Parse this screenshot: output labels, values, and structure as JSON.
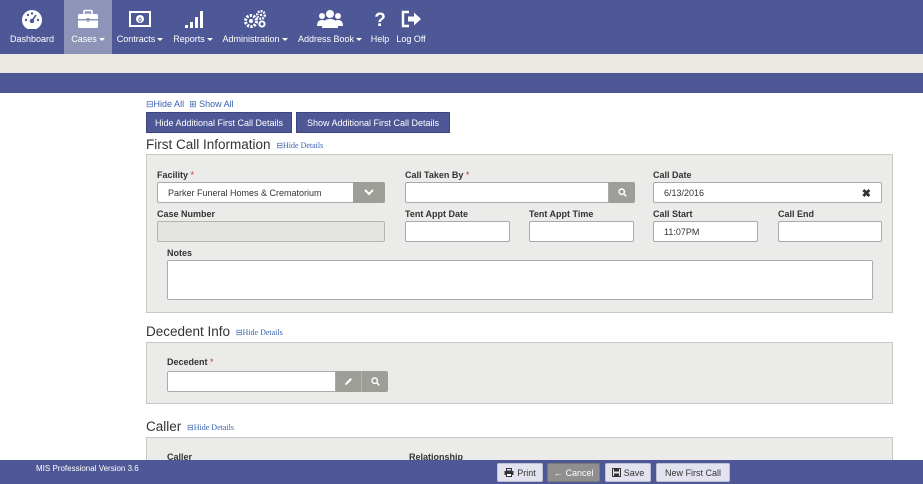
{
  "nav": {
    "items": [
      {
        "label": "Dashboard",
        "icon": "dashboard-icon",
        "has_caret": false
      },
      {
        "label": "Cases",
        "icon": "briefcase-icon",
        "has_caret": true,
        "active": true
      },
      {
        "label": "Contracts",
        "icon": "money-icon",
        "has_caret": true
      },
      {
        "label": "Reports",
        "icon": "bar-chart-icon",
        "has_caret": true
      },
      {
        "label": "Administration",
        "icon": "cogs-icon",
        "has_caret": true
      },
      {
        "label": "Address Book",
        "icon": "users-icon",
        "has_caret": true
      },
      {
        "label": "Help",
        "icon": "question-icon",
        "has_caret": false
      },
      {
        "label": "Log Off",
        "icon": "sign-out-icon",
        "has_caret": false
      }
    ]
  },
  "toggles": {
    "hide_all": "Hide All",
    "show_all": "Show All"
  },
  "buttons": {
    "hide_additional": "Hide Additional First Call Details",
    "show_additional": "Show Additional First Call Details"
  },
  "first_call": {
    "title": "First Call Information",
    "hide_details": "Hide Details",
    "facility_label": "Facility",
    "facility_value": "Parker Funeral Homes & Crematorium",
    "call_taken_by_label": "Call Taken By",
    "call_taken_by_value": "",
    "call_date_label": "Call Date",
    "call_date_value": "6/13/2016",
    "case_number_label": "Case Number",
    "case_number_value": "",
    "tent_appt_date_label": "Tent Appt Date",
    "tent_appt_time_label": "Tent Appt Time",
    "call_start_label": "Call Start",
    "call_start_value": "11:07PM",
    "call_end_label": "Call End",
    "call_end_value": "",
    "notes_label": "Notes",
    "required_mark": "*"
  },
  "decedent": {
    "title": "Decedent Info",
    "hide_details": "Hide Details",
    "decedent_label": "Decedent"
  },
  "caller": {
    "title": "Caller",
    "hide_details": "Hide Details",
    "caller_label": "Caller",
    "relationship_label": "Relationship"
  },
  "footer": {
    "version": "MIS Professional Version 3.6",
    "print": "Print",
    "cancel": "Cancel",
    "save": "Save",
    "new_first_call": "New First Call"
  },
  "colors": {
    "nav_bg": "#4e5896",
    "nav_active": "#8d94b8",
    "link": "#3a62b0",
    "panel_bg": "#ebebe9"
  }
}
